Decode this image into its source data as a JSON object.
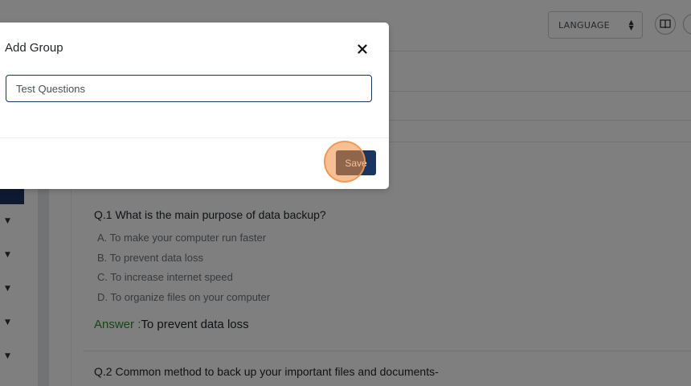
{
  "header": {
    "language_label": "LANGUAGE",
    "icons": [
      "book-icon"
    ]
  },
  "sidebar": {
    "items": [
      {
        "icon": "caret-down-icon"
      },
      {
        "icon": "caret-down-icon"
      },
      {
        "icon": "caret-down-icon"
      },
      {
        "icon": "caret-down-icon"
      },
      {
        "icon": "caret-down-icon"
      }
    ]
  },
  "questions": [
    {
      "text": "Q.1 What is the main purpose of data backup?",
      "options": [
        "A. To make your computer run faster",
        "B. To prevent data loss",
        "C. To increase internet speed",
        "D. To organize files on your computer"
      ],
      "answer_label": "Answer",
      "answer_sep": " :",
      "answer_value": "To prevent data loss"
    },
    {
      "text": "Q.2 Common method to back up your important files and documents-"
    }
  ],
  "modal": {
    "title": "Add Group",
    "close_icon": "close-icon",
    "input_value": "Test Questions",
    "save_label": "Save"
  },
  "colors": {
    "primary": "#1a3560",
    "answer_green": "#2e8b2e",
    "click_highlight": "#f08c3c"
  }
}
